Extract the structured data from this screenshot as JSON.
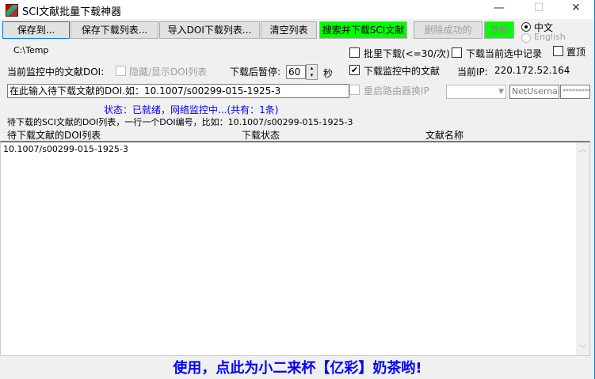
{
  "window": {
    "title": "SCI文献批量下载神器",
    "minimize": "—",
    "maximize": "☐",
    "close": "✕"
  },
  "toolbar": {
    "save_to": "保存到...",
    "save_list": "保存下载列表...",
    "import_list": "导入DOI下载列表...",
    "clear_list": "清空列表",
    "search_download": "搜索并下载SCI文献",
    "delete_success": "删除成功的",
    "update": "更新"
  },
  "language": {
    "chinese": "中文",
    "english": "English"
  },
  "save_path": "C:\\Temp",
  "monitor": {
    "label": "当前监控中的文献DOI:",
    "toggle_list": "隐藏/显示DOI列表",
    "pause_label": "下载后暂停:",
    "pause_value": "60",
    "seconds": "秒"
  },
  "options": {
    "batch": "批里下载(<=30/次)",
    "download_selected": "下载当前选中记录",
    "topmost": "置顶",
    "download_monitored": "下载监控中的文献",
    "ip_label": "当前IP:",
    "ip_value": "220.172.52.164",
    "restart_router": "重启路由器换IP"
  },
  "doi_input": {
    "value": "在此输入待下载文献的DOI.如：10.1007/s00299-015-1925-3"
  },
  "router": {
    "username": "NetUsernam",
    "password": "*********"
  },
  "status": "状态：已就绪，网络监控中...(共有：1条)",
  "hint": "待下载的SCI文献的DOI列表，一行一个DOI编号，比如：10.1007/s00299-015-1925-3",
  "columns": [
    "待下载文献的DOI列表",
    "下载状态",
    "文献名称"
  ],
  "rows": [
    "10.1007/s00299-015-1925-3"
  ],
  "footer": "使用，点此为小二来杯【亿彩】奶茶哟!"
}
